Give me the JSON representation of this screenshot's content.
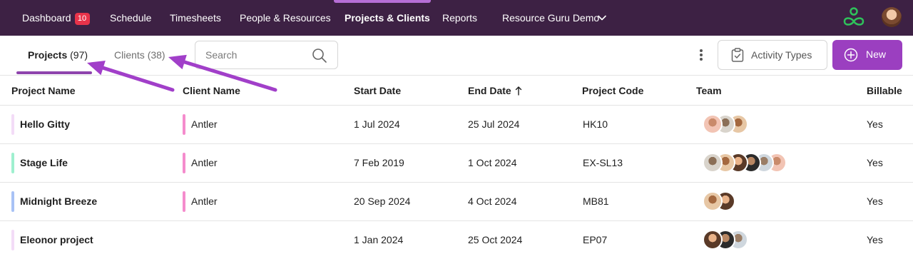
{
  "nav": {
    "items": [
      {
        "label": "Dashboard",
        "badge": "10"
      },
      {
        "label": "Schedule"
      },
      {
        "label": "Timesheets"
      },
      {
        "label": "People & Resources"
      },
      {
        "label": "Projects & Clients",
        "active": true
      },
      {
        "label": "Reports"
      }
    ],
    "account": "Resource Guru Demo",
    "colors": {
      "bar": "#3d2144",
      "active_indicator": "#b66ed6",
      "badge": "#e8334a",
      "logo": "#2fc25b"
    }
  },
  "toolbar": {
    "tabs": [
      {
        "label": "Projects",
        "count": "(97)",
        "active": true
      },
      {
        "label": "Clients",
        "count": "(38)"
      }
    ],
    "search_placeholder": "Search",
    "activity_types_label": "Activity Types",
    "new_label": "New",
    "accent": "#9b3fc0"
  },
  "table": {
    "columns": [
      "Project Name",
      "Client Name",
      "Start Date",
      "End Date",
      "Project Code",
      "Team",
      "Billable"
    ],
    "sorted_column": "End Date",
    "sort_direction": "ascending",
    "rows": [
      {
        "name": "Hello Gitty",
        "client": "Antler",
        "start": "1 Jul 2024",
        "end": "25 Jul 2024",
        "code": "HK10",
        "billable": "Yes",
        "project_color": "#f3dcf7",
        "client_color": "#f58ccd",
        "team_count": 3
      },
      {
        "name": "Stage Life",
        "client": "Antler",
        "start": "7 Feb 2019",
        "end": "1 Oct 2024",
        "code": "EX-SL13",
        "billable": "Yes",
        "project_color": "#9ff0cf",
        "client_color": "#f58ccd",
        "team_count": 6
      },
      {
        "name": "Midnight Breeze",
        "client": "Antler",
        "start": "20 Sep 2024",
        "end": "4 Oct 2024",
        "code": "MB81",
        "billable": "Yes",
        "project_color": "#a8c2f5",
        "client_color": "#f58ccd",
        "team_count": 2
      },
      {
        "name": "Eleonor project",
        "client": "",
        "start": "1 Jan 2024",
        "end": "25 Oct 2024",
        "code": "EP07",
        "billable": "Yes",
        "project_color": "#f3dcf7",
        "client_color": "",
        "team_count": 3
      }
    ]
  },
  "annotation": {
    "arrow_color": "#a13fc9"
  }
}
